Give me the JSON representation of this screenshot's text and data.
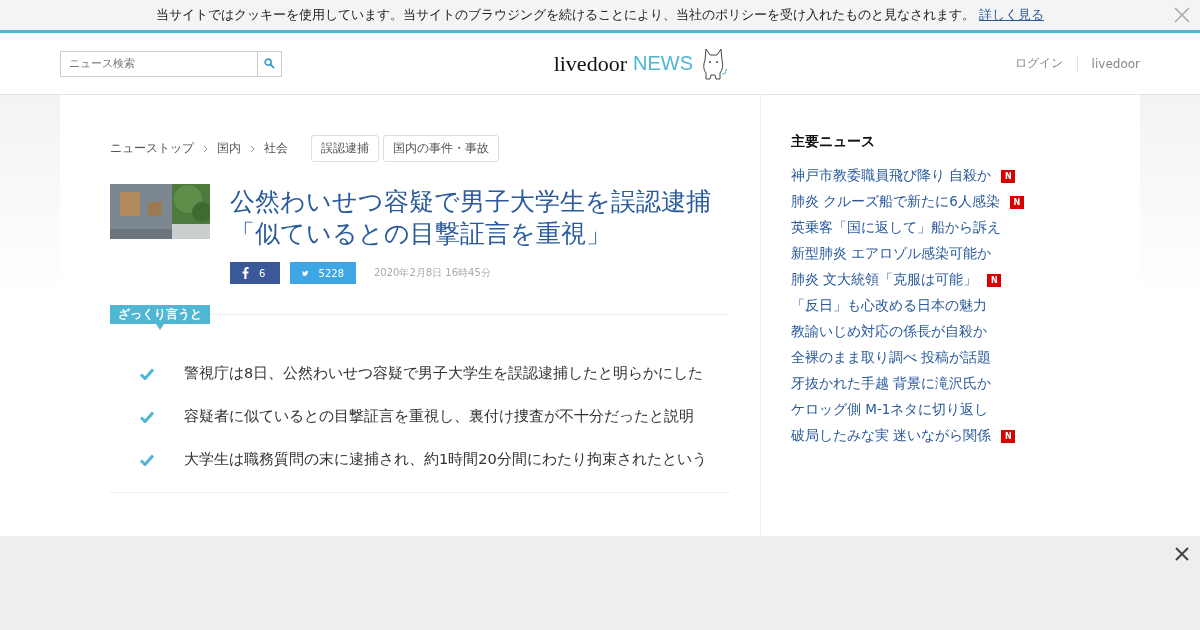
{
  "cookie_bar": {
    "message": "当サイトではクッキーを使用しています。当サイトのブラウジングを続けることにより、当社のポリシーを受け入れたものと見なされます。",
    "link": "詳しく見る"
  },
  "header": {
    "search": {
      "placeholder": "ニュース検索"
    },
    "logo": {
      "word": "livedoor",
      "sub": "NEWS"
    },
    "links": [
      "ログイン",
      "livedoor"
    ]
  },
  "breadcrumb": [
    "ニューストップ",
    "国内",
    "社会"
  ],
  "tags": [
    "誤認逮捕",
    "国内の事件・事故"
  ],
  "article": {
    "title": "公然わいせつ容疑で男子大学生を誤認逮捕「似ているとの目撃証言を重視」",
    "facebook_count": "6",
    "twitter_count": "5228",
    "date": "2020年2月8日 16時45分",
    "summary_label": "ざっくり言うと",
    "summary": [
      "警視庁は8日、公然わいせつ容疑で男子大学生を誤認逮捕したと明らかにした",
      "容疑者に似ているとの目撃証言を重視し、裏付け捜査が不十分だったと説明",
      "大学生は職務質問の末に逮捕され、約1時間20分間にわたり拘束されたという"
    ]
  },
  "sidebar": {
    "title": "主要ニュース",
    "items": [
      {
        "text": "神戸市教委職員飛び降り 自殺か",
        "badge": "N"
      },
      {
        "text": "肺炎 クルーズ船で新たに6人感染",
        "badge": "N"
      },
      {
        "text": "英乗客「国に返して」船から訴え"
      },
      {
        "text": "新型肺炎 エアロゾル感染可能か"
      },
      {
        "text": "肺炎 文大統領「克服は可能」",
        "badge": "N"
      },
      {
        "text": "「反日」も心改める日本の魅力"
      },
      {
        "text": "教諭いじめ対応の係長が自殺か"
      },
      {
        "text": "全裸のまま取り調べ 投稿が話題"
      },
      {
        "text": "牙抜かれた手越 背景に滝沢氏か"
      },
      {
        "text": "ケロッグ側 M-1ネタに切り返し"
      },
      {
        "text": "破局したみな実 迷いながら関係",
        "badge": "N"
      }
    ]
  }
}
